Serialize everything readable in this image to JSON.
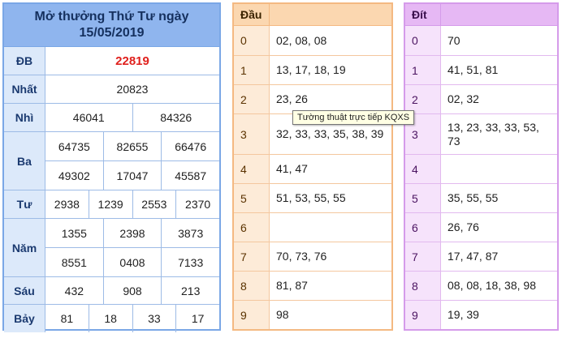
{
  "results": {
    "title_line1": "Mở thưởng Thứ Tư ngày",
    "title_line2": "15/05/2019",
    "prizes": [
      {
        "label": "ĐB",
        "lines": [
          [
            "22819"
          ]
        ]
      },
      {
        "label": "Nhất",
        "lines": [
          [
            "20823"
          ]
        ]
      },
      {
        "label": "Nhì",
        "lines": [
          [
            "46041",
            "84326"
          ]
        ]
      },
      {
        "label": "Ba",
        "lines": [
          [
            "64735",
            "82655",
            "66476"
          ],
          [
            "49302",
            "17047",
            "45587"
          ]
        ]
      },
      {
        "label": "Tư",
        "lines": [
          [
            "2938",
            "1239",
            "2553",
            "2370"
          ]
        ]
      },
      {
        "label": "Năm",
        "lines": [
          [
            "1355",
            "2398",
            "3873"
          ],
          [
            "8551",
            "0408",
            "7133"
          ]
        ]
      },
      {
        "label": "Sáu",
        "lines": [
          [
            "432",
            "908",
            "213"
          ]
        ]
      },
      {
        "label": "Bảy",
        "lines": [
          [
            "81",
            "18",
            "33",
            "17"
          ]
        ]
      }
    ]
  },
  "dau": {
    "header": "Đầu",
    "rows": [
      {
        "key": "0",
        "value": "02, 08, 08"
      },
      {
        "key": "1",
        "value": "13, 17, 18, 19"
      },
      {
        "key": "2",
        "value": "23, 26"
      },
      {
        "key": "3",
        "value": "32, 33, 33, 35, 38, 39"
      },
      {
        "key": "4",
        "value": "41, 47"
      },
      {
        "key": "5",
        "value": "51, 53, 55, 55"
      },
      {
        "key": "6",
        "value": ""
      },
      {
        "key": "7",
        "value": "70, 73, 76"
      },
      {
        "key": "8",
        "value": "81, 87"
      },
      {
        "key": "9",
        "value": "98"
      }
    ]
  },
  "dit": {
    "header": "Đít",
    "rows": [
      {
        "key": "0",
        "value": "70"
      },
      {
        "key": "1",
        "value": "41, 51, 81"
      },
      {
        "key": "2",
        "value": "02, 32"
      },
      {
        "key": "3",
        "value": "13, 23, 33, 33, 53, 73"
      },
      {
        "key": "4",
        "value": ""
      },
      {
        "key": "5",
        "value": "35, 55, 55"
      },
      {
        "key": "6",
        "value": "26, 76"
      },
      {
        "key": "7",
        "value": "17, 47, 87"
      },
      {
        "key": "8",
        "value": "08, 08, 18, 38, 98"
      },
      {
        "key": "9",
        "value": "19, 39"
      }
    ]
  },
  "tooltip": "Tường thuật trực tiếp KQXS"
}
